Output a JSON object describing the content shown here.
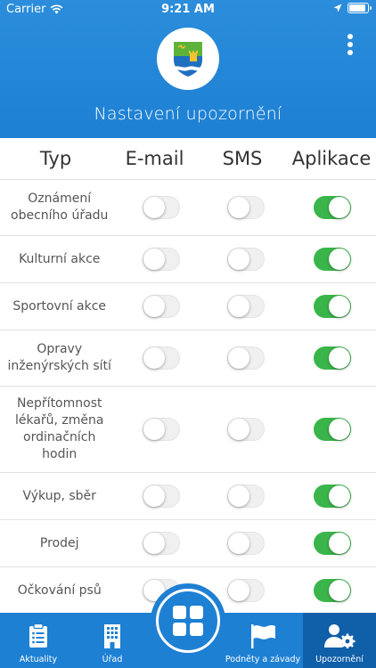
{
  "status": {
    "carrier": "Carrier",
    "time": "9:21 AM"
  },
  "header": {
    "title": "Nastavení upozornění",
    "logo_icon": "municipal-coat-of-arms-icon",
    "menu_icon": "more-vertical-icon"
  },
  "table": {
    "columns": [
      "Typ",
      "E-mail",
      "SMS",
      "Aplikace"
    ],
    "rows": [
      {
        "label": "Oznámení obecního úřadu",
        "email": false,
        "sms": false,
        "app": true
      },
      {
        "label": "Kulturní akce",
        "email": false,
        "sms": false,
        "app": true
      },
      {
        "label": "Sportovní akce",
        "email": false,
        "sms": false,
        "app": true
      },
      {
        "label": "Opravy inženýrských sítí",
        "email": false,
        "sms": false,
        "app": true
      },
      {
        "label": "Nepřítomnost lékařů, změna ordinačních hodin",
        "email": false,
        "sms": false,
        "app": true
      },
      {
        "label": "Výkup, sběr",
        "email": false,
        "sms": false,
        "app": true
      },
      {
        "label": "Prodej",
        "email": false,
        "sms": false,
        "app": true
      },
      {
        "label": "Očkování psů",
        "email": false,
        "sms": false,
        "app": true
      }
    ]
  },
  "tabbar": {
    "tabs": [
      {
        "label": "Aktuality",
        "icon": "clipboard-icon"
      },
      {
        "label": "Úřad",
        "icon": "building-icon"
      },
      {
        "label": "Podněty a závady",
        "icon": "flag-icon"
      },
      {
        "label": "Upozornění",
        "icon": "user-settings-icon"
      }
    ],
    "center_icon": "grid-icon"
  },
  "colors": {
    "primary": "#1e80d3",
    "active_tab": "#0f5fa9",
    "switch_on": "#3ab54a",
    "switch_off": "#f0f0f0"
  }
}
